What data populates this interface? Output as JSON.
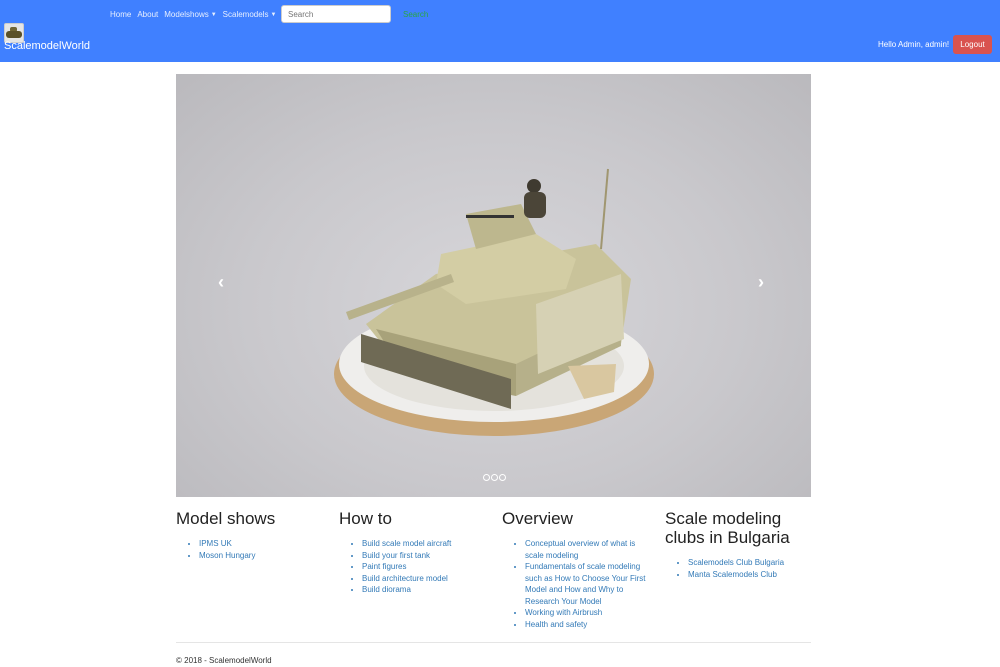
{
  "navbar": {
    "brand": "ScalemodelWorld",
    "links": [
      "Home",
      "About"
    ],
    "dropdowns": [
      "Modelshows",
      "Scalemodels"
    ],
    "search_placeholder": "Search",
    "search_button": "Search",
    "greeting": "Hello Admin, admin!",
    "logout": "Logout"
  },
  "carousel": {
    "prev_icon": "‹",
    "next_icon": "›",
    "slide_count": 3,
    "active_slide": 1
  },
  "sections": [
    {
      "title": "Model shows",
      "items": [
        "IPMS UK",
        "Moson Hungary"
      ]
    },
    {
      "title": "How to",
      "items": [
        "Build scale model aircraft",
        "Build your first tank",
        "Paint figures",
        "Build architecture model",
        "Build diorama"
      ]
    },
    {
      "title": "Overview",
      "items": [
        "Conceptual overview of what is scale modeling",
        "Fundamentals of scale modeling such as How to Choose Your First Model and How and Why to Research Your Model",
        "Working with Airbrush",
        "Health and safety"
      ]
    },
    {
      "title": "Scale modeling clubs in Bulgaria",
      "items": [
        "Scalemodels Club Bulgaria",
        "Manta Scalemodels Club"
      ]
    }
  ],
  "footer": "© 2018 - ScalemodelWorld"
}
